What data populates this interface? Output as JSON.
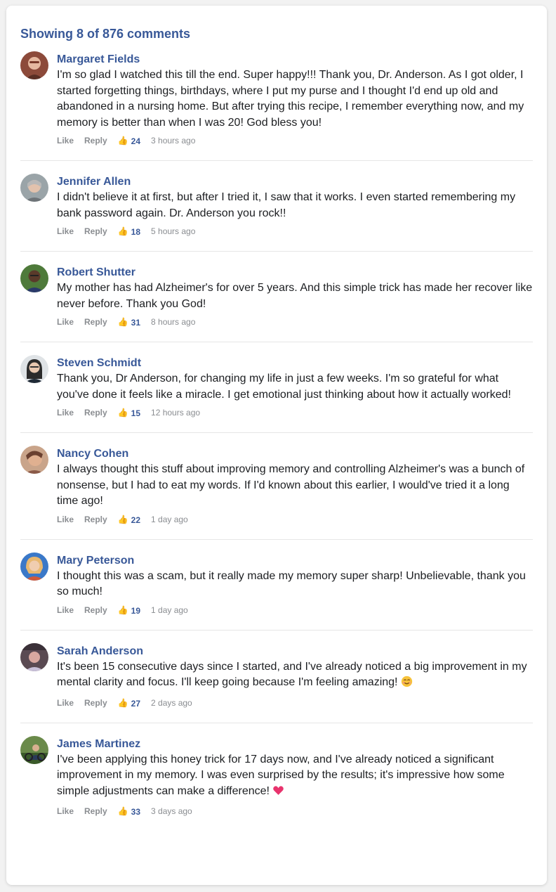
{
  "header": {
    "showing_text": "Showing 8 of 876 comments"
  },
  "labels": {
    "like": "Like",
    "reply": "Reply"
  },
  "comments": [
    {
      "name": "Margaret Fields",
      "text": "I'm so glad I watched this till the end. Super happy!!! Thank you, Dr. Anderson. As I got older, I started forgetting things, birthdays, where I put my purse and I thought I'd end up old and abandoned in a nursing home. But after trying this recipe, I remember everything now, and my memory is better than when I was 20! God bless you!",
      "likes": "24",
      "time": "3 hours ago"
    },
    {
      "name": "Jennifer Allen",
      "text": "I didn't believe it at first, but after I tried it, I saw that it works. I even started remembering my bank password again. Dr. Anderson you rock!!",
      "likes": "18",
      "time": "5 hours ago"
    },
    {
      "name": "Robert Shutter",
      "text": "My mother has had Alzheimer's for over 5 years. And this simple trick has made her recover like never before. Thank you God!",
      "likes": "31",
      "time": "8 hours ago"
    },
    {
      "name": "Steven Schmidt",
      "text": "Thank you, Dr Anderson, for changing my life in just a few weeks. I'm so grateful for what you've done it feels like a miracle. I get emotional just thinking about how it actually worked!",
      "likes": "15",
      "time": "12 hours ago"
    },
    {
      "name": "Nancy Cohen",
      "text": "I always thought this stuff about improving memory and controlling Alzheimer's was a bunch of nonsense, but I had to eat my words. If I'd known about this earlier, I would've tried it a long time ago!",
      "likes": "22",
      "time": "1 day ago"
    },
    {
      "name": "Mary Peterson",
      "text": "I thought this was a scam, but it really made my memory super sharp! Unbelievable, thank you so much!",
      "likes": "19",
      "time": "1 day ago"
    },
    {
      "name": "Sarah Anderson",
      "text": "It's been 15 consecutive days since I started, and I've already noticed a big improvement in my mental clarity and focus. I'll keep going because I'm feeling amazing!",
      "emoji": "smiling-face-emoji",
      "likes": "27",
      "time": "2 days ago"
    },
    {
      "name": "James Martinez",
      "text": "I've been applying this honey trick for 17 days now, and I've already noticed a significant improvement in my memory. I was even surprised by the results; it's impressive how some simple adjustments can make a difference!",
      "emoji": "pink-heart-emoji",
      "likes": "33",
      "time": "3 days ago"
    }
  ],
  "colors": {
    "accent": "#385898",
    "muted": "#8a8d91",
    "text": "#1c1e21",
    "divider": "#e6e6e6",
    "like_icon": "#f7b125"
  },
  "icons": {
    "like": "thumbs-up-icon"
  }
}
